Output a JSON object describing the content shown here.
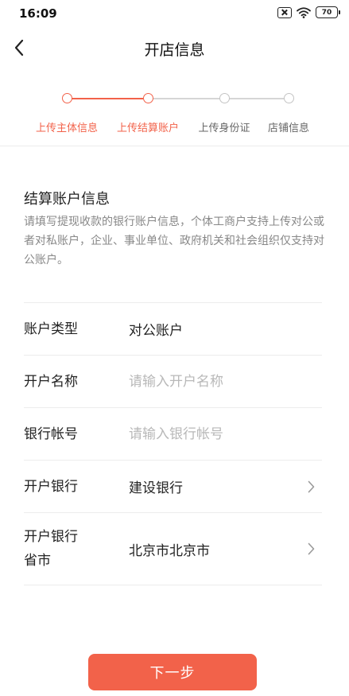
{
  "status_bar": {
    "time": "16:09",
    "battery": "70"
  },
  "header": {
    "title": "开店信息"
  },
  "colors": {
    "accent": "#f2624a",
    "inactive": "#bdbdbd"
  },
  "steps": [
    {
      "label": "上传主体信息",
      "state": "done"
    },
    {
      "label": "上传结算账户",
      "state": "current"
    },
    {
      "label": "上传身份证",
      "state": "pending"
    },
    {
      "label": "店铺信息",
      "state": "pending"
    }
  ],
  "section": {
    "title": "结算账户信息",
    "description": "请填写提现收款的银行账户信息，个体工商户支持上传对公或者对私账户，企业、事业单位、政府机关和社会组织仅支持对公账户。"
  },
  "form": {
    "account_type": {
      "label": "账户类型",
      "value": "对公账户"
    },
    "account_name": {
      "label": "开户名称",
      "value": "",
      "placeholder": "请输入开户名称"
    },
    "account_number": {
      "label": "银行帐号",
      "value": "",
      "placeholder": "请输入银行帐号"
    },
    "bank": {
      "label": "开户银行",
      "value": "建设银行"
    },
    "bank_region": {
      "label_line1": "开户银行",
      "label_line2": "省市",
      "value": "北京市北京市"
    }
  },
  "footer": {
    "next_label": "下一步"
  }
}
